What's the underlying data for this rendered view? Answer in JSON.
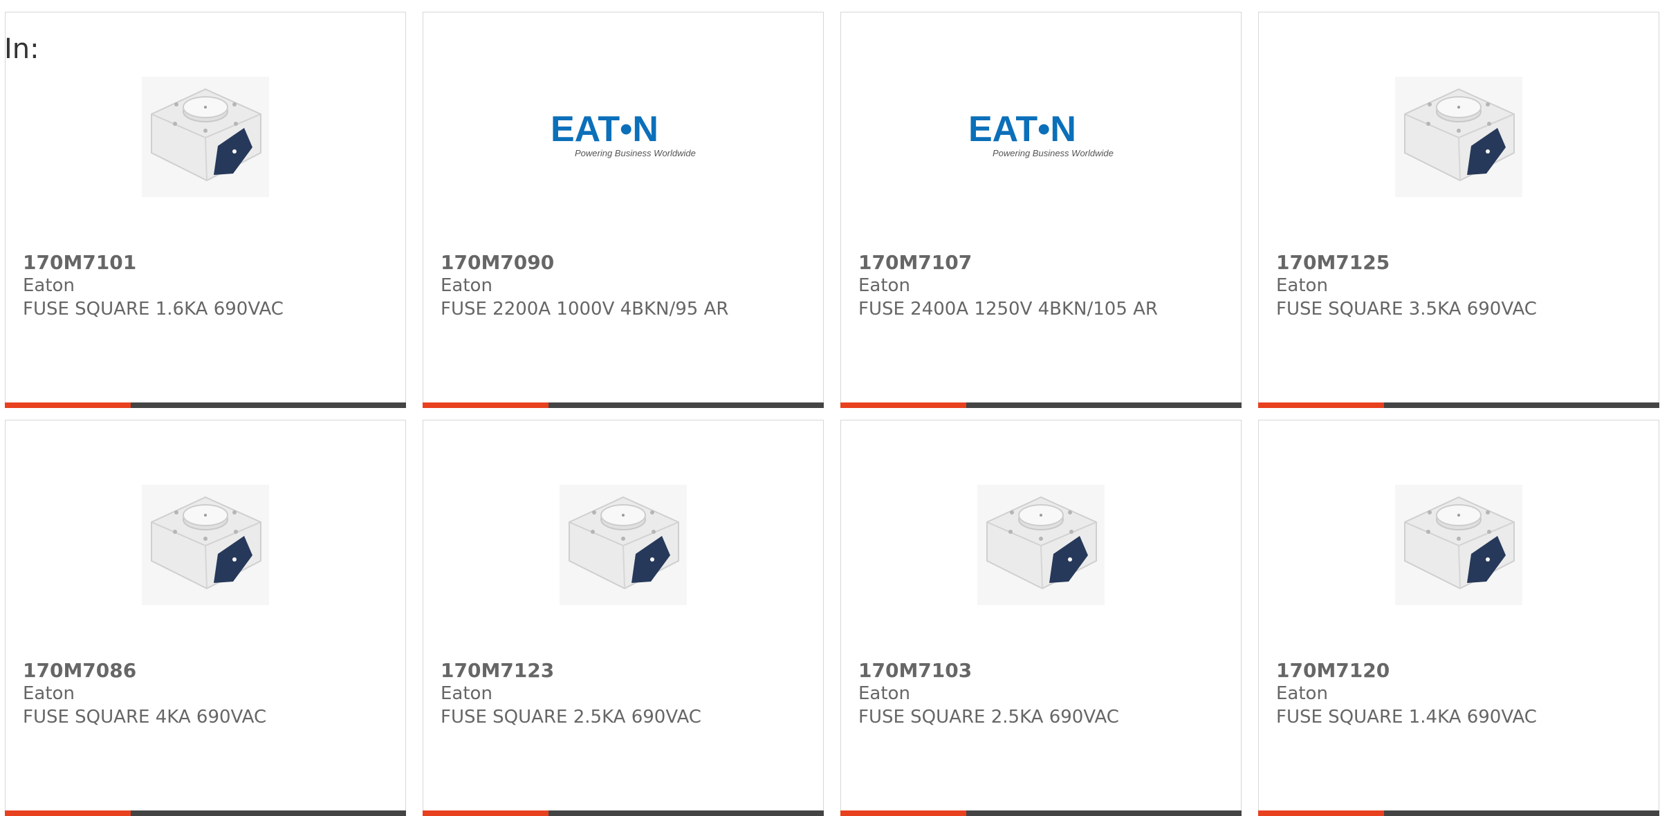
{
  "header": {
    "label": "In:"
  },
  "colors": {
    "accent": "#e8411f",
    "bar_dark": "#444444",
    "eaton_blue": "#0b6fb9",
    "text": "#666666",
    "border": "#d7d7d7"
  },
  "products": [
    {
      "part_number": "170M7101",
      "manufacturer": "Eaton",
      "description": "FUSE SQUARE 1.6KA 690VAC",
      "image": "fuse-product-icon"
    },
    {
      "part_number": "170M7090",
      "manufacturer": "Eaton",
      "description": "FUSE 2200A 1000V 4BKN/95 AR",
      "image": "eaton-logo",
      "logo_text": "EAT•N",
      "logo_tagline": "Powering Business Worldwide"
    },
    {
      "part_number": "170M7107",
      "manufacturer": "Eaton",
      "description": "FUSE 2400A 1250V 4BKN/105 AR",
      "image": "eaton-logo",
      "logo_text": "EAT•N",
      "logo_tagline": "Powering Business Worldwide"
    },
    {
      "part_number": "170M7125",
      "manufacturer": "Eaton",
      "description": "FUSE SQUARE 3.5KA 690VAC",
      "image": "fuse-product-icon"
    },
    {
      "part_number": "170M7086",
      "manufacturer": "Eaton",
      "description": "FUSE SQUARE 4KA 690VAC",
      "image": "fuse-product-icon"
    },
    {
      "part_number": "170M7123",
      "manufacturer": "Eaton",
      "description": "FUSE SQUARE 2.5KA 690VAC",
      "image": "fuse-product-icon"
    },
    {
      "part_number": "170M7103",
      "manufacturer": "Eaton",
      "description": "FUSE SQUARE 2.5KA 690VAC",
      "image": "fuse-product-icon"
    },
    {
      "part_number": "170M7120",
      "manufacturer": "Eaton",
      "description": "FUSE SQUARE 1.4KA 690VAC",
      "image": "fuse-product-icon"
    }
  ]
}
